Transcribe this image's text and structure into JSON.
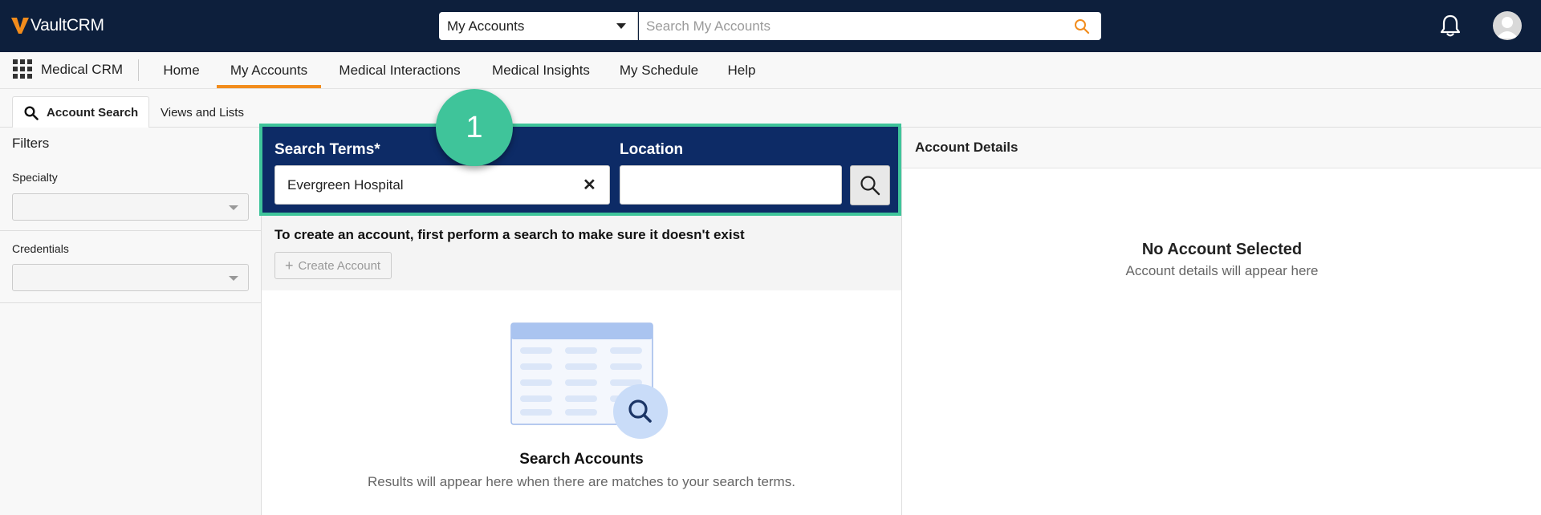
{
  "header": {
    "logo": {
      "prefix": "Vault",
      "suffix": "CRM",
      "accent_color": "#f28c1c"
    },
    "scope_select": {
      "value": "My Accounts"
    },
    "global_search": {
      "placeholder": "Search My Accounts"
    }
  },
  "nav": {
    "app_name": "Medical CRM",
    "tabs": [
      {
        "label": "Home",
        "active": false
      },
      {
        "label": "My Accounts",
        "active": true
      },
      {
        "label": "Medical Interactions",
        "active": false
      },
      {
        "label": "Medical Insights",
        "active": false
      },
      {
        "label": "My Schedule",
        "active": false
      },
      {
        "label": "Help",
        "active": false
      }
    ]
  },
  "subtabs": [
    {
      "label": "Account Search",
      "active": true,
      "icon": "search-icon"
    },
    {
      "label": "Views and Lists",
      "active": false
    }
  ],
  "filters": {
    "title": "Filters",
    "fields": [
      {
        "label": "Specialty",
        "value": ""
      },
      {
        "label": "Credentials",
        "value": ""
      }
    ]
  },
  "search_panel": {
    "terms_label": "Search Terms*",
    "terms_value": "Evergreen Hospital",
    "clear_symbol": "✕",
    "location_label": "Location",
    "location_value": "",
    "highlight_color": "#3fc49a",
    "panel_color": "#0d2b66"
  },
  "step_marker": "1",
  "create_account": {
    "hint": "To create an account, first perform a search to make sure it doesn't exist",
    "button_label": "Create Account"
  },
  "results_empty": {
    "title": "Search Accounts",
    "subtitle": "Results will appear here when there are matches to your search terms."
  },
  "account_details": {
    "header": "Account Details",
    "empty_title": "No Account Selected",
    "empty_subtitle": "Account details will appear here"
  }
}
